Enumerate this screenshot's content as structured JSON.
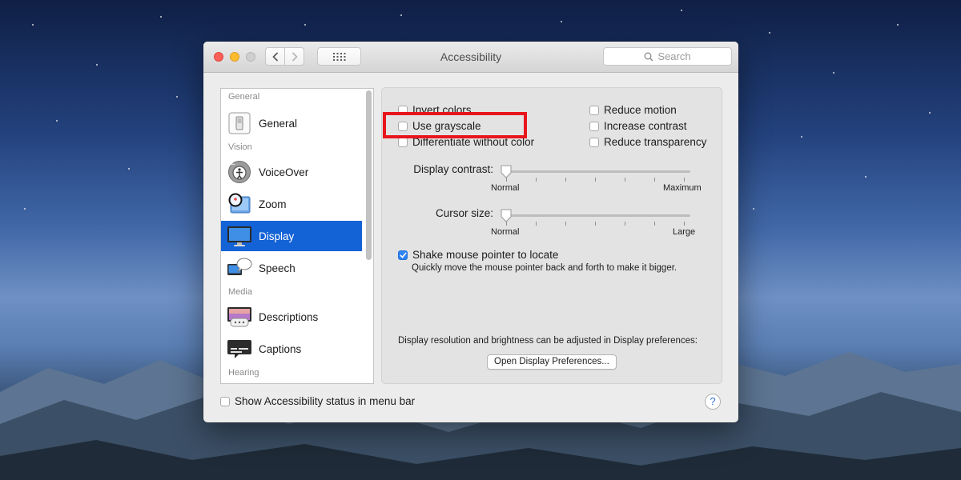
{
  "window": {
    "title": "Accessibility",
    "search_placeholder": "Search"
  },
  "sidebar": {
    "sections": [
      "General",
      "Vision",
      "Media",
      "Hearing"
    ],
    "items": [
      {
        "label": "General",
        "icon": "general-switch-icon"
      },
      {
        "label": "VoiceOver",
        "icon": "voiceover-icon"
      },
      {
        "label": "Zoom",
        "icon": "zoom-magnifier-icon"
      },
      {
        "label": "Display",
        "icon": "display-monitor-icon",
        "selected": true
      },
      {
        "label": "Speech",
        "icon": "speech-bubble-icon"
      },
      {
        "label": "Descriptions",
        "icon": "descriptions-icon"
      },
      {
        "label": "Captions",
        "icon": "captions-icon"
      }
    ]
  },
  "options": {
    "invert_colors": {
      "label": "Invert colors",
      "checked": false
    },
    "use_grayscale": {
      "label": "Use grayscale",
      "checked": false
    },
    "differentiate": {
      "label": "Differentiate without color",
      "checked": false
    },
    "reduce_motion": {
      "label": "Reduce motion",
      "checked": false
    },
    "increase_contrast": {
      "label": "Increase contrast",
      "checked": false
    },
    "reduce_transparency": {
      "label": "Reduce transparency",
      "checked": false
    }
  },
  "display_contrast": {
    "label": "Display contrast:",
    "min_label": "Normal",
    "max_label": "Maximum",
    "value": 0
  },
  "cursor_size": {
    "label": "Cursor size:",
    "min_label": "Normal",
    "max_label": "Large",
    "value": 0
  },
  "shake": {
    "label": "Shake mouse pointer to locate",
    "description": "Quickly move the mouse pointer back and forth to make it bigger.",
    "checked": true
  },
  "footer": {
    "prefs_text": "Display resolution and brightness can be adjusted in Display preferences:",
    "open_button": "Open Display Preferences...",
    "status_checkbox": "Show Accessibility status in menu bar",
    "help": "?"
  },
  "colors": {
    "selection": "#1362d6",
    "highlight": "#e8161c",
    "checkbox_on": "#2f84f4"
  }
}
